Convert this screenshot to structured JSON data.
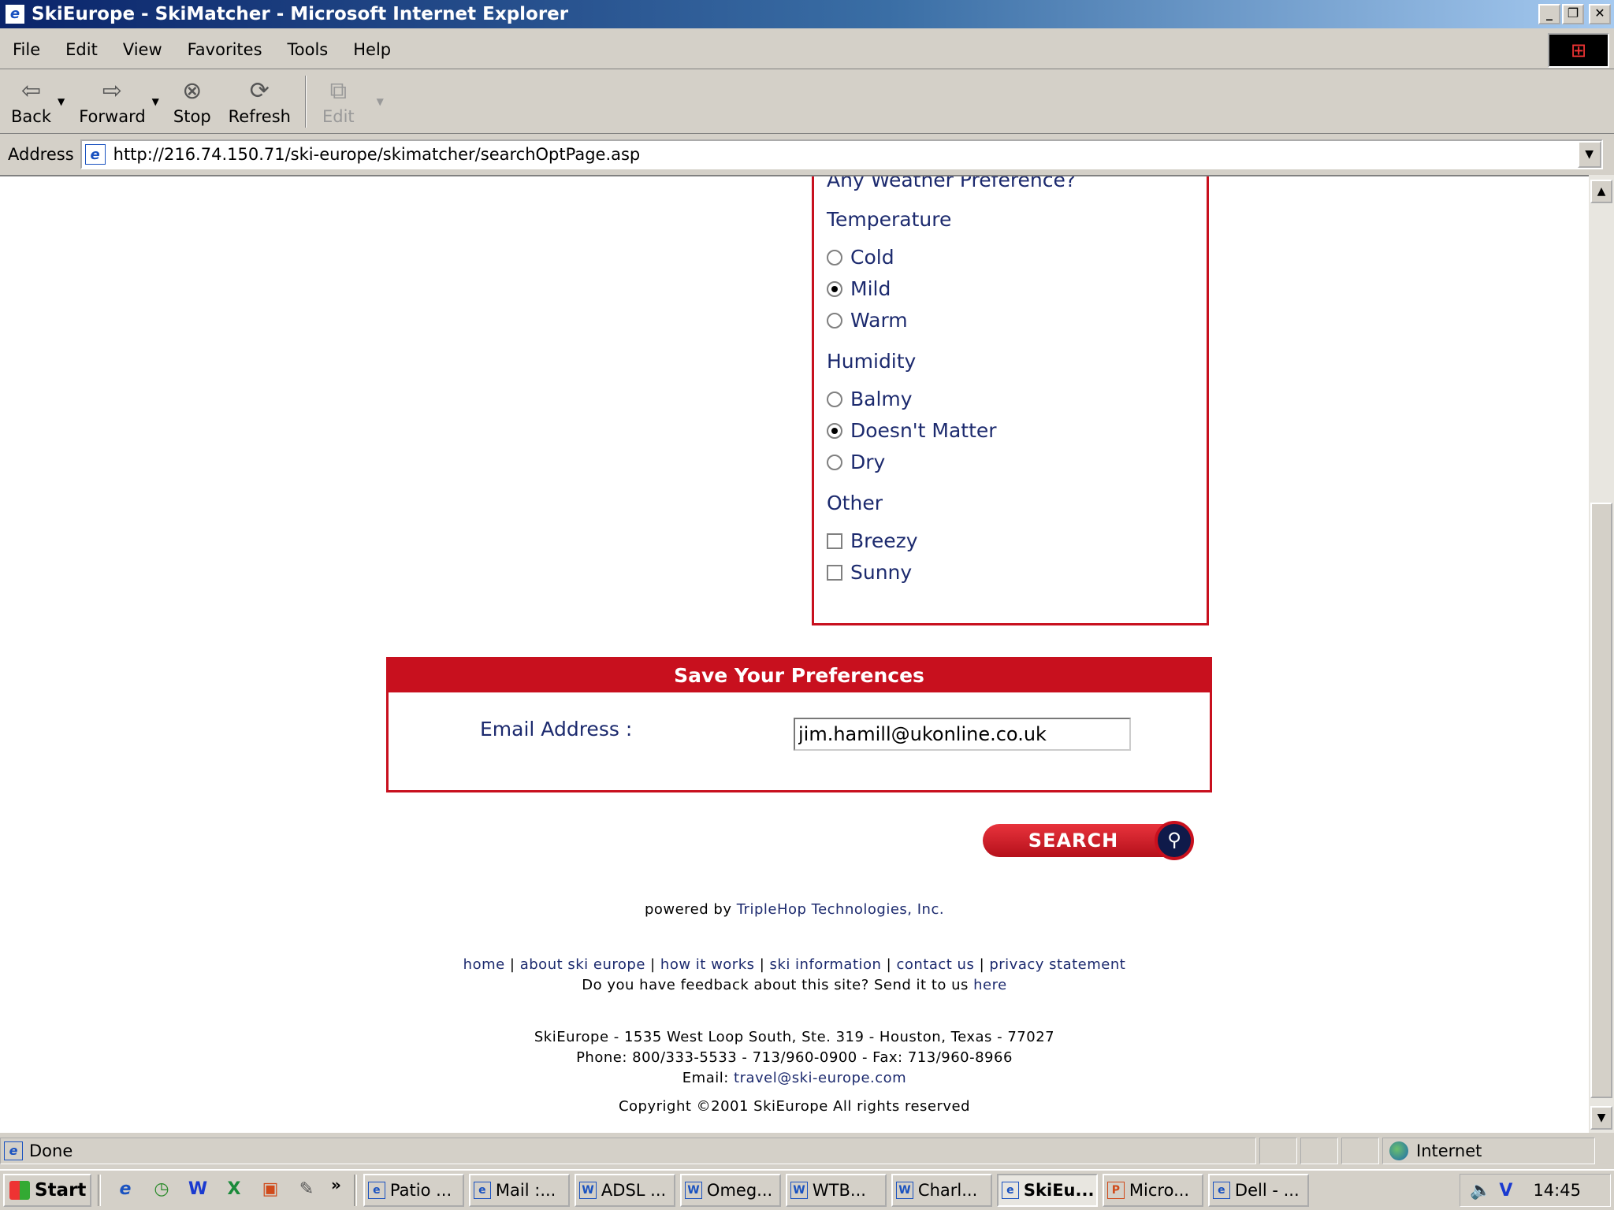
{
  "window": {
    "title": "SkiEurope - SkiMatcher - Microsoft Internet Explorer",
    "buttons": {
      "minimize": "_",
      "restore": "❐",
      "close": "✕"
    }
  },
  "menu": {
    "items": [
      "File",
      "Edit",
      "View",
      "Favorites",
      "Tools",
      "Help"
    ]
  },
  "toolbar": {
    "back": "Back",
    "forward": "Forward",
    "stop": "Stop",
    "refresh": "Refresh",
    "edit": "Edit"
  },
  "address": {
    "label": "Address",
    "url": "http://216.74.150.71/ski-europe/skimatcher/searchOptPage.asp"
  },
  "weather": {
    "question": "Any Weather Preference?",
    "temperature": {
      "label": "Temperature",
      "options": [
        "Cold",
        "Mild",
        "Warm"
      ],
      "selected": "Mild"
    },
    "humidity": {
      "label": "Humidity",
      "options": [
        "Balmy",
        "Doesn't Matter",
        "Dry"
      ],
      "selected": "Doesn't Matter"
    },
    "other": {
      "label": "Other",
      "options": [
        "Breezy",
        "Sunny"
      ]
    }
  },
  "save": {
    "header": "Save Your Preferences",
    "email_label": "Email Address :",
    "email_value": "jim.hamill@ukonline.co.uk"
  },
  "search_button": "SEARCH",
  "footer": {
    "powered_prefix": "powered by ",
    "powered_link": "TripleHop Technologies, Inc.",
    "links": [
      "home",
      "about ski europe",
      "how it works",
      "ski information",
      "contact us",
      "privacy statement"
    ],
    "feedback_prefix": "Do you have feedback about this site? Send it to us ",
    "feedback_link": "here",
    "address_line": "SkiEurope - 1535 West Loop South, Ste. 319 - Houston, Texas - 77027",
    "phone_line": "Phone: 800/333-5533 - 713/960-0900 - Fax: 713/960-8966",
    "email_prefix": "Email: ",
    "email_link": "travel@ski-europe.com",
    "copyright": "Copyright ©2001 SkiEurope All rights reserved"
  },
  "status": {
    "text": "Done",
    "zone": "Internet"
  },
  "taskbar": {
    "start": "Start",
    "more": "»",
    "tasks": [
      "Patio ...",
      "Mail :...",
      "ADSL ...",
      "Omeg...",
      "WTB...",
      "Charl...",
      "SkiEu...",
      "Micro...",
      "Dell - ..."
    ],
    "active_task": "SkiEu...",
    "clock": "14:45"
  }
}
